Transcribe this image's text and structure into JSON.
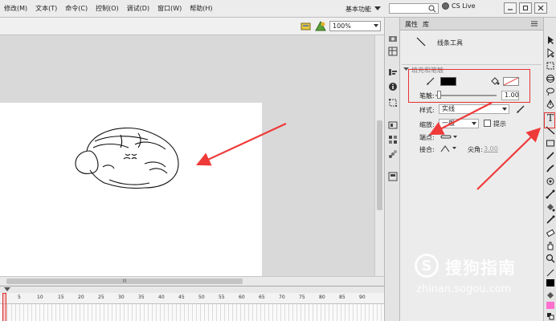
{
  "menu": {
    "items": [
      "修改(M)",
      "文本(T)",
      "命令(C)",
      "控制(O)",
      "调试(D)",
      "窗口(W)",
      "帮助(H)"
    ],
    "workspace": "基本功能",
    "cs_live": "CS Live"
  },
  "editbar": {
    "zoom": "100%"
  },
  "timeline": {
    "ticks": [
      "5",
      "10",
      "15",
      "20",
      "25",
      "30",
      "35",
      "40",
      "45",
      "50",
      "55",
      "60",
      "65",
      "70",
      "75",
      "80",
      "85",
      "90"
    ]
  },
  "scroll": {
    "h_grip": "III"
  },
  "properties": {
    "tabs": {
      "properties": "属性",
      "library": "库"
    },
    "tool_name": "线条工具",
    "section": "填充和笔触",
    "stroke_size_label": "笔触:",
    "stroke_size_value": "1.00",
    "style_label": "样式:",
    "style_value": "实线",
    "scale_label": "缩放:",
    "scale_value": "一般",
    "hint_label": "提示",
    "cap_label": "端点:",
    "join_label": "接合:",
    "miter_label": "尖角:",
    "miter_value": "3.00"
  },
  "colors": {
    "stroke": "#000000",
    "highlight": "#e63232",
    "accent": "#ef3a3a"
  },
  "watermark": {
    "brand": "搜狗指南",
    "url": "zhinan.sogou.com"
  }
}
